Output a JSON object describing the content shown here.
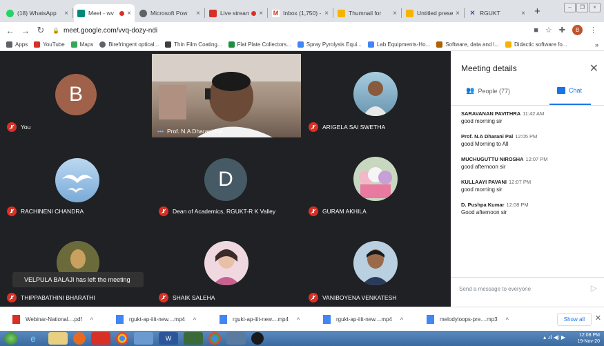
{
  "tabs": [
    {
      "title": "(18) WhatsApp",
      "color": "#25d366"
    },
    {
      "title": "Meet - wv",
      "color": "#00897b",
      "recording": true
    },
    {
      "title": "Microsoft Pow",
      "color": "#5f6368"
    },
    {
      "title": "Live stream",
      "color": "#d93025",
      "recording": true
    },
    {
      "title": "Inbox (1,750) -",
      "color": "#d93025"
    },
    {
      "title": "Thumnail for",
      "color": "#f4b400"
    },
    {
      "title": "Untitled presen",
      "color": "#f4b400"
    },
    {
      "title": "RGUKT",
      "color": "#5f6368"
    }
  ],
  "address": {
    "url": "meet.google.com/vvq-dozy-ndi",
    "profile": "B"
  },
  "bookmarks": [
    {
      "label": "Apps",
      "color": "#5f6368"
    },
    {
      "label": "YouTube",
      "color": "#d93025"
    },
    {
      "label": "Maps",
      "color": "#34a853"
    },
    {
      "label": "Birefringent optical...",
      "color": "#5f6368"
    },
    {
      "label": "Thin Film Coating...",
      "color": "#3c4043"
    },
    {
      "label": "Flat Plate Collectors...",
      "color": "#1e8e3e"
    },
    {
      "label": "Spray Pyrolysis Equi...",
      "color": "#4285f4"
    },
    {
      "label": "Lab Equipments-Ho...",
      "color": "#4285f4"
    },
    {
      "label": "Software, data and l...",
      "color": "#b06000"
    },
    {
      "label": "Didactic software fo...",
      "color": "#f4b400"
    }
  ],
  "participants": [
    {
      "name": "You",
      "avatar": "B"
    },
    {
      "name": "Prof. N.A Dharani Pal"
    },
    {
      "name": "ARIGELA SAI SWETHA"
    },
    {
      "name": "RACHINENI CHANDRA"
    },
    {
      "name": "Dean of Academics, RGUKT-R K Valley",
      "avatar": "D"
    },
    {
      "name": "GURAM AKHILA"
    },
    {
      "name": "THIPPABATHINI BHARATHI"
    },
    {
      "name": "SHAIK SALEHA"
    },
    {
      "name": "VANIBOYENA VENKATESH"
    }
  ],
  "toast": "VELPULA BALAJI has left the meeting",
  "panel": {
    "title": "Meeting details",
    "people_label": "People (77)",
    "chat_label": "Chat",
    "messages": [
      {
        "sender": "SARAVANAN PAVITHRA",
        "time": "11:42 AM",
        "text": "good morning sir"
      },
      {
        "sender": "Prof. N.A Dharani Pal",
        "time": "12:05 PM",
        "text": "good Morning to All"
      },
      {
        "sender": "MUCHUGUTTU NIROSHA",
        "time": "12:07 PM",
        "text": "good afternoon sir"
      },
      {
        "sender": "KULLAAYI PAVANI",
        "time": "12:07 PM",
        "text": "good morning sir"
      },
      {
        "sender": "D. Pushpa Kumar",
        "time": "12:08 PM",
        "text": "Good afternoon sir"
      }
    ],
    "input_placeholder": "Send a message to everyone"
  },
  "downloads": [
    {
      "name": "Webinar-National....pdf",
      "color": "#d93025"
    },
    {
      "name": "rgukt-ap-iiit-new....mp4",
      "color": "#4285f4"
    },
    {
      "name": "rgukt-ap-iiit-new....mp4",
      "color": "#4285f4"
    },
    {
      "name": "rgukt-ap-iiit-new....mp4",
      "color": "#4285f4"
    },
    {
      "name": "melodyloops-pre....mp3",
      "color": "#4285f4"
    }
  ],
  "show_all": "Show all",
  "clock": {
    "time": "12:08 PM",
    "date": "19-Nov-20"
  }
}
